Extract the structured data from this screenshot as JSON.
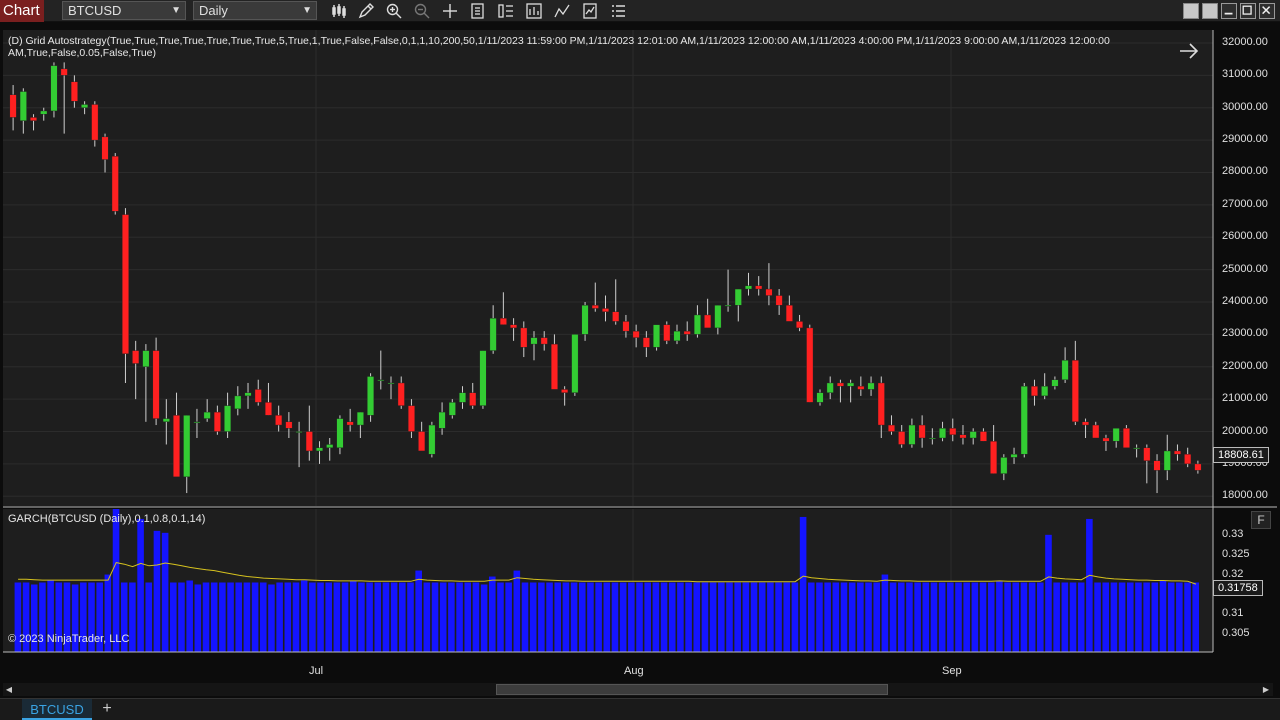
{
  "toolbar": {
    "chart_label": "Chart",
    "instrument": "BTCUSD",
    "interval": "Daily",
    "icons": [
      "bar-type-icon",
      "drawing-tool-icon",
      "zoom-in-icon",
      "zoom-out-icon",
      "crosshair-icon",
      "data-series-icon",
      "properties-icon",
      "strategies-icon",
      "indicators-icon",
      "templates-icon",
      "menu-icon"
    ]
  },
  "strategy": {
    "line1": "(D) Grid Autostrategy(True,True,True,True,True,True,True,5,True,1,True,False,False,0,1,1,10,200,50,1/11/2023 11:59:00 PM,1/11/2023 12:01:00 AM,1/11/2023 12:00:00 AM,1/11/2023 4:00:00 PM,1/11/2023 9:00:00 AM,1/11/2023 12:00:00",
    "line2": "AM,True,False,0.05,False,True)"
  },
  "price_axis": [
    "32000.00",
    "31000.00",
    "30000.00",
    "29000.00",
    "28000.00",
    "27000.00",
    "26000.00",
    "25000.00",
    "24000.00",
    "23000.00",
    "22000.00",
    "21000.00",
    "20000.00",
    "19000.00",
    "18000.00"
  ],
  "last_price": "18808.61",
  "indicator": {
    "title": "GARCH(BTCUSD (Daily),0.1,0.8,0.1,14)",
    "axis": [
      "0.33",
      "0.325",
      "0.32",
      "0.315",
      "0.31",
      "0.305"
    ],
    "last_value": "0.31758",
    "f_button": "F"
  },
  "copyright": "© 2023 NinjaTrader, LLC",
  "time_axis": [
    "Jul",
    "Aug",
    "Sep"
  ],
  "bottom_tab": "BTCUSD",
  "colors": {
    "up": "#33cc33",
    "down": "#ff2020",
    "bar": "#1414ff",
    "line": "#d6c21e"
  },
  "chart_data": [
    {
      "type": "candlestick",
      "ylim": [
        17700,
        32400
      ],
      "candles": [
        [
          30400,
          30700,
          29300,
          29700
        ],
        [
          29600,
          30600,
          29200,
          30500
        ],
        [
          29700,
          29800,
          29300,
          29600
        ],
        [
          29800,
          30000,
          29600,
          29900
        ],
        [
          29900,
          31400,
          29700,
          31300
        ],
        [
          31200,
          31400,
          29200,
          31000
        ],
        [
          30800,
          31000,
          30000,
          30200
        ],
        [
          30000,
          30200,
          29800,
          30100
        ],
        [
          30100,
          30200,
          28800,
          29000
        ],
        [
          29100,
          29200,
          28000,
          28400
        ],
        [
          28500,
          28600,
          26700,
          26800
        ],
        [
          26700,
          26900,
          21500,
          22400
        ],
        [
          22500,
          22800,
          21000,
          22100
        ],
        [
          22000,
          22700,
          20300,
          22500
        ],
        [
          22500,
          22900,
          20200,
          20400
        ],
        [
          20300,
          21000,
          19600,
          20400
        ],
        [
          20500,
          21200,
          19100,
          18600
        ],
        [
          18600,
          20500,
          18100,
          20500
        ],
        [
          20300,
          20700,
          19800,
          20300
        ],
        [
          20400,
          21000,
          20300,
          20600
        ],
        [
          20600,
          20800,
          19900,
          20000
        ],
        [
          20000,
          21200,
          19800,
          20800
        ],
        [
          20700,
          21400,
          20500,
          21100
        ],
        [
          21100,
          21500,
          20700,
          21200
        ],
        [
          21300,
          21600,
          20800,
          20900
        ],
        [
          20900,
          21500,
          20500,
          20500
        ],
        [
          20500,
          20800,
          20000,
          20200
        ],
        [
          20300,
          20600,
          19800,
          20100
        ],
        [
          20000,
          20300,
          18900,
          20000
        ],
        [
          20000,
          20800,
          19100,
          19400
        ],
        [
          19400,
          19700,
          19000,
          19500
        ],
        [
          19500,
          19800,
          19100,
          19600
        ],
        [
          19500,
          20500,
          19300,
          20400
        ],
        [
          20300,
          20700,
          20000,
          20200
        ],
        [
          20200,
          20600,
          19800,
          20600
        ],
        [
          20500,
          21800,
          20300,
          21700
        ],
        [
          21600,
          22500,
          21300,
          21600
        ],
        [
          21500,
          21700,
          21000,
          21500
        ],
        [
          21500,
          21700,
          20700,
          20800
        ],
        [
          20800,
          21000,
          19800,
          20000
        ],
        [
          20000,
          20300,
          19500,
          19400
        ],
        [
          19300,
          20300,
          19200,
          20200
        ],
        [
          20100,
          20900,
          19900,
          20600
        ],
        [
          20500,
          21000,
          20400,
          20900
        ],
        [
          20900,
          21400,
          20700,
          21200
        ],
        [
          21200,
          21500,
          20700,
          20800
        ],
        [
          20800,
          22500,
          20700,
          22500
        ],
        [
          22500,
          23900,
          22400,
          23500
        ],
        [
          23500,
          24300,
          23300,
          23300
        ],
        [
          23300,
          23500,
          22800,
          23200
        ],
        [
          23200,
          23400,
          22300,
          22600
        ],
        [
          22700,
          23100,
          22200,
          22900
        ],
        [
          22900,
          23100,
          22500,
          22700
        ],
        [
          22700,
          23000,
          21900,
          21300
        ],
        [
          21300,
          21400,
          20800,
          21200
        ],
        [
          21200,
          23000,
          21100,
          23000
        ],
        [
          23000,
          24000,
          22800,
          23900
        ],
        [
          23900,
          24600,
          23700,
          23800
        ],
        [
          23800,
          24200,
          23400,
          23700
        ],
        [
          23700,
          24700,
          23300,
          23400
        ],
        [
          23400,
          23600,
          22900,
          23100
        ],
        [
          23100,
          23300,
          22600,
          22900
        ],
        [
          22900,
          23100,
          22300,
          22600
        ],
        [
          22600,
          23100,
          22500,
          23300
        ],
        [
          23300,
          23400,
          22700,
          22800
        ],
        [
          22800,
          23300,
          22700,
          23100
        ],
        [
          23100,
          23400,
          22800,
          23000
        ],
        [
          23000,
          23900,
          22900,
          23600
        ],
        [
          23600,
          24100,
          23300,
          23200
        ],
        [
          23200,
          23900,
          23000,
          23900
        ],
        [
          23900,
          25000,
          23700,
          23900
        ],
        [
          23900,
          24400,
          23400,
          24400
        ],
        [
          24400,
          24900,
          24200,
          24500
        ],
        [
          24500,
          24800,
          24200,
          24400
        ],
        [
          24400,
          25200,
          23900,
          24200
        ],
        [
          24200,
          24400,
          23600,
          23900
        ],
        [
          23900,
          24200,
          23500,
          23400
        ],
        [
          23400,
          23600,
          23100,
          23200
        ],
        [
          23200,
          23300,
          20900,
          20900
        ],
        [
          20900,
          21300,
          20800,
          21200
        ],
        [
          21200,
          21700,
          21000,
          21500
        ],
        [
          21500,
          21600,
          20900,
          21400
        ],
        [
          21400,
          21600,
          20900,
          21500
        ],
        [
          21400,
          21700,
          21100,
          21300
        ],
        [
          21300,
          21700,
          21100,
          21500
        ],
        [
          21500,
          21700,
          19800,
          20200
        ],
        [
          20200,
          20500,
          19900,
          20000
        ],
        [
          20000,
          20200,
          19500,
          19600
        ],
        [
          19600,
          20400,
          19500,
          20200
        ],
        [
          20200,
          20500,
          19500,
          19800
        ],
        [
          19800,
          20100,
          19600,
          19800
        ],
        [
          19800,
          20300,
          19700,
          20100
        ],
        [
          20100,
          20400,
          19700,
          19900
        ],
        [
          19900,
          20200,
          19600,
          19800
        ],
        [
          19800,
          20100,
          19600,
          20000
        ],
        [
          20000,
          20100,
          19700,
          19700
        ],
        [
          19700,
          20200,
          18700,
          18700
        ],
        [
          18700,
          19300,
          18500,
          19200
        ],
        [
          19200,
          19500,
          19000,
          19300
        ],
        [
          19300,
          21500,
          19200,
          21400
        ],
        [
          21400,
          21600,
          20800,
          21100
        ],
        [
          21100,
          21800,
          21000,
          21400
        ],
        [
          21400,
          21700,
          21300,
          21600
        ],
        [
          21600,
          22600,
          21500,
          22200
        ],
        [
          22200,
          22800,
          20200,
          20300
        ],
        [
          20300,
          20400,
          19800,
          20200
        ],
        [
          20200,
          20300,
          19800,
          19800
        ],
        [
          19800,
          19900,
          19400,
          19700
        ],
        [
          19700,
          20000,
          19500,
          20100
        ],
        [
          20100,
          20200,
          19600,
          19500
        ],
        [
          19500,
          19600,
          19200,
          19500
        ],
        [
          19500,
          19600,
          18400,
          19100
        ],
        [
          19100,
          19300,
          18100,
          18800
        ],
        [
          18800,
          19900,
          18500,
          19400
        ],
        [
          19400,
          19600,
          19100,
          19300
        ],
        [
          19300,
          19500,
          18900,
          19000
        ],
        [
          19000,
          19100,
          18700,
          18800
        ]
      ]
    },
    {
      "type": "bar",
      "title": "GARCH(BTCUSD (Daily),0.1,0.8,0.1,14)",
      "ylim": [
        0.3005,
        0.3365
      ],
      "values": [
        0.318,
        0.318,
        0.3175,
        0.318,
        0.3185,
        0.318,
        0.318,
        0.3175,
        0.318,
        0.318,
        0.318,
        0.32,
        0.3365,
        0.318,
        0.318,
        0.334,
        0.318,
        0.331,
        0.3305,
        0.318,
        0.318,
        0.3185,
        0.3175,
        0.318,
        0.318,
        0.318,
        0.318,
        0.318,
        0.318,
        0.318,
        0.318,
        0.3175,
        0.318,
        0.318,
        0.318,
        0.3185,
        0.318,
        0.318,
        0.318,
        0.318,
        0.318,
        0.3185,
        0.318,
        0.318,
        0.318,
        0.318,
        0.318,
        0.318,
        0.318,
        0.321,
        0.318,
        0.318,
        0.318,
        0.318,
        0.318,
        0.318,
        0.318,
        0.3175,
        0.3195,
        0.318,
        0.318,
        0.321,
        0.318,
        0.318,
        0.318,
        0.318,
        0.318,
        0.318,
        0.318,
        0.318,
        0.318,
        0.318,
        0.318,
        0.318,
        0.318,
        0.318,
        0.318,
        0.318,
        0.318,
        0.318,
        0.318,
        0.318,
        0.318,
        0.318,
        0.318,
        0.318,
        0.318,
        0.318,
        0.318,
        0.318,
        0.318,
        0.318,
        0.318,
        0.318,
        0.318,
        0.318,
        0.3345,
        0.318,
        0.318,
        0.318,
        0.318,
        0.318,
        0.318,
        0.318,
        0.318,
        0.318,
        0.32,
        0.318,
        0.318,
        0.318,
        0.318,
        0.318,
        0.318,
        0.318,
        0.318,
        0.318,
        0.318,
        0.318,
        0.318,
        0.318,
        0.3185,
        0.318,
        0.318,
        0.318,
        0.318,
        0.318,
        0.33,
        0.318,
        0.318,
        0.318,
        0.318,
        0.334,
        0.318,
        0.318,
        0.318,
        0.318,
        0.318,
        0.318,
        0.318,
        0.318,
        0.3185,
        0.318,
        0.318,
        0.318,
        0.318
      ],
      "line": [
        0.3188,
        0.3188,
        0.3187,
        0.3186,
        0.3186,
        0.3186,
        0.3186,
        0.3186,
        0.3186,
        0.3186,
        0.3186,
        0.3186,
        0.323,
        0.3226,
        0.322,
        0.3228,
        0.3222,
        0.3224,
        0.3229,
        0.3226,
        0.3222,
        0.3218,
        0.3215,
        0.3212,
        0.321,
        0.3206,
        0.3202,
        0.3198,
        0.3195,
        0.3193,
        0.3191,
        0.319,
        0.3189,
        0.3188,
        0.3187,
        0.3187,
        0.3186,
        0.3185,
        0.3185,
        0.3184,
        0.3184,
        0.3184,
        0.3184,
        0.3183,
        0.3183,
        0.3183,
        0.3183,
        0.3183,
        0.3183,
        0.3188,
        0.3186,
        0.3185,
        0.3184,
        0.3184,
        0.3183,
        0.3183,
        0.3183,
        0.3183,
        0.3186,
        0.3186,
        0.3186,
        0.3192,
        0.319,
        0.3188,
        0.3187,
        0.3186,
        0.3185,
        0.3184,
        0.3184,
        0.3183,
        0.3183,
        0.3183,
        0.3183,
        0.3183,
        0.3183,
        0.3183,
        0.3183,
        0.3183,
        0.3183,
        0.3183,
        0.3183,
        0.3183,
        0.3183,
        0.3182,
        0.3182,
        0.3182,
        0.3182,
        0.3182,
        0.3182,
        0.3182,
        0.3182,
        0.3182,
        0.3182,
        0.3182,
        0.3182,
        0.3182,
        0.3196,
        0.3192,
        0.319,
        0.3188,
        0.3187,
        0.3186,
        0.3185,
        0.3184,
        0.3184,
        0.3183,
        0.3186,
        0.3185,
        0.3184,
        0.3184,
        0.3183,
        0.3183,
        0.3183,
        0.3183,
        0.3183,
        0.3183,
        0.3183,
        0.3183,
        0.3183,
        0.3183,
        0.3184,
        0.3183,
        0.3183,
        0.3183,
        0.3183,
        0.3183,
        0.3194,
        0.3191,
        0.3189,
        0.3188,
        0.3187,
        0.3198,
        0.3194,
        0.3191,
        0.3189,
        0.3188,
        0.3187,
        0.3186,
        0.3186,
        0.3185,
        0.3185,
        0.3184,
        0.3184,
        0.3183,
        0.3176
      ]
    }
  ]
}
